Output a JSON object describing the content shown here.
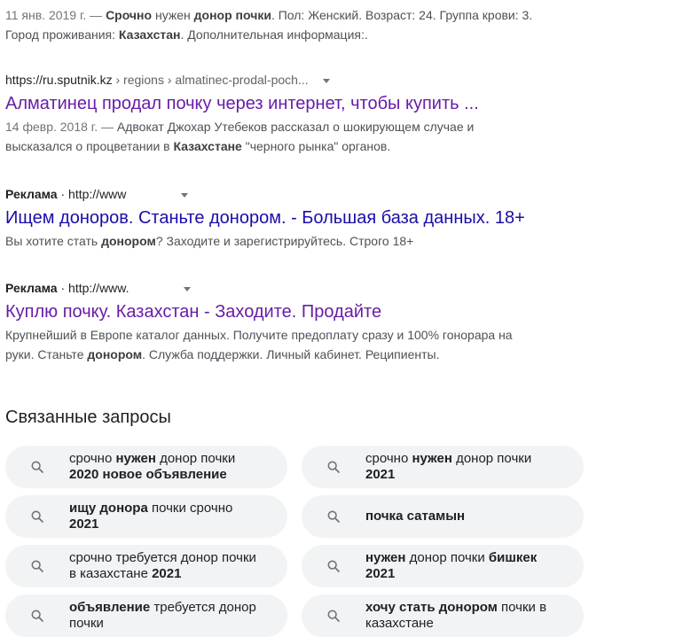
{
  "results": [
    {
      "type": "organic",
      "snippet_html": "<span class=\"date\">11 янв. 2019 г. — </span><b>Срочно</b> нужен <b>донор почки</b>. Пол: Женский. Возраст: 24. Группа крови: 3.<br>Город проживания: <b>Казахстан</b>. Дополнительная информация:."
    },
    {
      "type": "organic",
      "url_host": "https://ru.sputnik.kz",
      "url_path": " › regions › almatinec-prodal-poch...",
      "title": "Алматинец продал почку через интернет, чтобы купить ...",
      "snippet_html": "<span class=\"date\">14 февр. 2018 г. — </span>Адвокат Джохар Утебеков рассказал о шокирующем случае и<br>высказался о процветании в <b>Казахстане</b> \"черного рынка\" органов."
    },
    {
      "type": "ad",
      "ad_label": "Реклама",
      "url": "http://www",
      "title": "Ищем доноров. Станьте донором. - Большая база данных. 18+",
      "snippet_html": "Вы хотите стать <b>донором</b>? Заходите и зарегистрируйтесь. Строго 18+"
    },
    {
      "type": "ad",
      "ad_label": "Реклама",
      "url": "http://www.",
      "title": "Куплю почку. Казахстан - Заходите. Продайте",
      "snippet_html": "Крупнейший в Европе каталог данных. Получите предоплату сразу и 100% гонорара на<br>руки. Станьте <b>донором</b>. Служба поддержки. Личный кабинет. Реципиенты."
    }
  ],
  "related": {
    "heading": "Связанные запросы",
    "queries": [
      {
        "html": "срочно <b>нужен</b> донор почки<br><b>2020 новое объявление</b>"
      },
      {
        "html": "срочно <b>нужен</b> донор почки<br><b>2021</b>"
      },
      {
        "html": "<b>ищу донора</b> почки срочно<br><b>2021</b>"
      },
      {
        "html": "<b>почка сатамын</b>"
      },
      {
        "html": "срочно требуется донор почки<br>в казахстане <b>2021</b>"
      },
      {
        "html": "<b>нужен</b> донор почки <b>бишкек</b><br><b>2021</b>"
      },
      {
        "html": "<b>объявление</b> требуется донор<br>почки"
      },
      {
        "html": "<b>хочу стать донором</b> почки в<br>казахстане"
      }
    ]
  }
}
